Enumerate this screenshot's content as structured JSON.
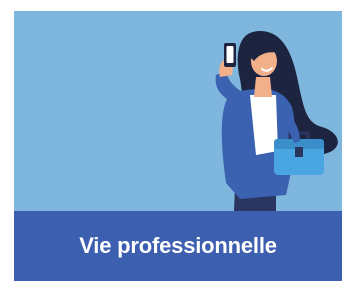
{
  "card": {
    "label": "Vie professionnelle",
    "illustration_icon": "woman-on-phone-with-briefcase-illustration",
    "colors": {
      "background": "#7fb6dd",
      "label_bar": "#3d5fb0",
      "label_text": "#ffffff"
    }
  }
}
